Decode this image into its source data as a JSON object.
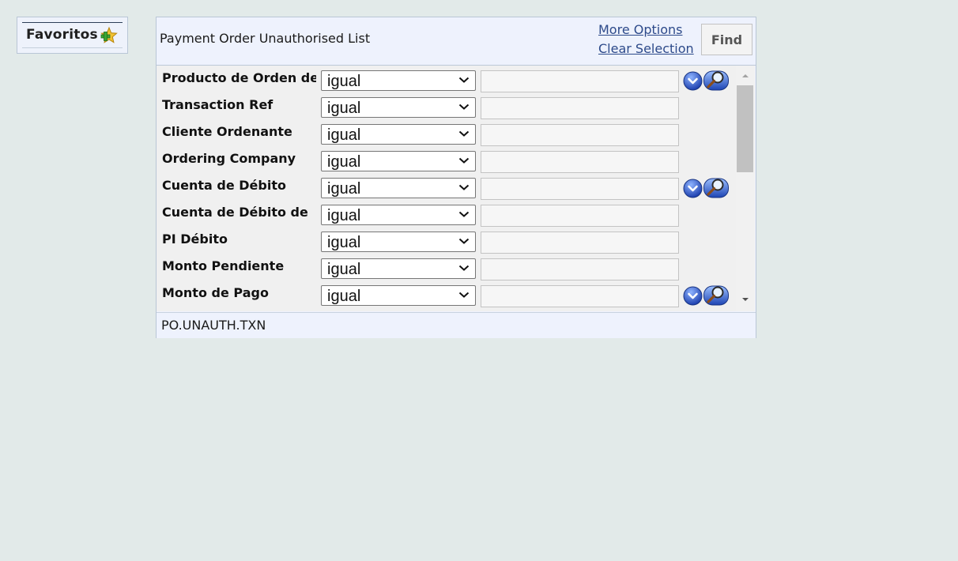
{
  "favorites": {
    "label": "Favoritos",
    "add_icon": "add-favorite-star-icon"
  },
  "header": {
    "title": "Payment Order Unauthorised List",
    "more_options": "More Options",
    "clear_selection": "Clear Selection",
    "find_label": "Find"
  },
  "criteria": [
    {
      "label": "Producto de Orden de",
      "operator": "igual",
      "value": "",
      "dropdown": true,
      "lookup": true
    },
    {
      "label": "Transaction Ref",
      "operator": "igual",
      "value": "",
      "dropdown": false,
      "lookup": false
    },
    {
      "label": "Cliente Ordenante",
      "operator": "igual",
      "value": "",
      "dropdown": false,
      "lookup": false
    },
    {
      "label": "Ordering Company",
      "operator": "igual",
      "value": "",
      "dropdown": false,
      "lookup": false
    },
    {
      "label": "Cuenta de Débito",
      "operator": "igual",
      "value": "",
      "dropdown": true,
      "lookup": true
    },
    {
      "label": "Cuenta de Débito de",
      "operator": "igual",
      "value": "",
      "dropdown": false,
      "lookup": false
    },
    {
      "label": "PI Débito",
      "operator": "igual",
      "value": "",
      "dropdown": false,
      "lookup": false
    },
    {
      "label": "Monto Pendiente",
      "operator": "igual",
      "value": "",
      "dropdown": false,
      "lookup": false
    },
    {
      "label": "Monto de Pago",
      "operator": "igual",
      "value": "",
      "dropdown": true,
      "lookup": true
    }
  ],
  "footer": {
    "enquiry_id": "PO.UNAUTH.TXN"
  },
  "colors": {
    "background": "#e2eae9",
    "panel": "#eef2fd",
    "link": "#2d4a8a",
    "icon_blue": "#2a56c6"
  }
}
